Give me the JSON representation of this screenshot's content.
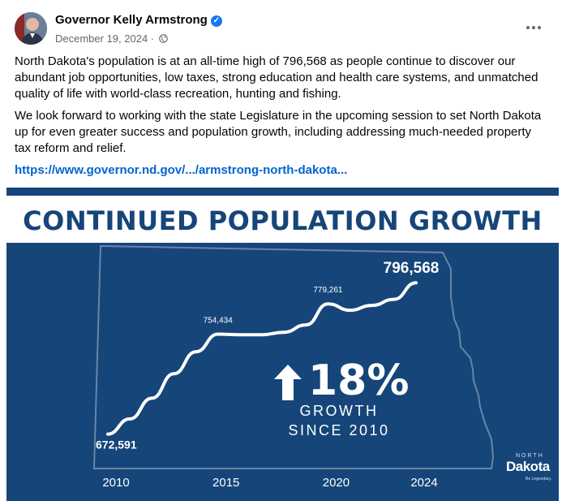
{
  "post": {
    "author": "Governor Kelly Armstrong",
    "date": "December 19, 2024",
    "date_suffix": " · ",
    "paragraph1": "North Dakota's population is at an all-time high of 796,568 as people continue to discover our abundant job opportunities, low taxes, strong education and health care systems, and unmatched quality of life with world-class recreation, hunting and fishing.",
    "paragraph2": "We look forward to working with the state Legislature in the upcoming session to set North Dakota up for even greater success and population growth, including addressing much-needed property tax reform and relief.",
    "link_text": "https://www.governor.nd.gov/.../armstrong-north-dakota..."
  },
  "graphic": {
    "title": "CONTINUED POPULATION GROWTH",
    "growth_percent": "18%",
    "growth_label": "GROWTH",
    "since_label": "SINCE 2010",
    "logo_top": "NORTH",
    "logo_name": "Dakota",
    "logo_tagline": "Be Legendary."
  },
  "colors": {
    "brand_blue": "#16457a",
    "link_blue": "#0064d1",
    "verified_blue": "#1877f2"
  },
  "chart_data": {
    "type": "line",
    "title": "CONTINUED POPULATION GROWTH",
    "x_ticks": [
      "2010",
      "2015",
      "2020",
      "2024"
    ],
    "x": [
      2010,
      2011,
      2012,
      2013,
      2014,
      2015,
      2016,
      2017,
      2018,
      2019,
      2020,
      2021,
      2022,
      2023,
      2024
    ],
    "values": [
      672591,
      685000,
      702000,
      722000,
      740000,
      754434,
      754000,
      754000,
      756000,
      762000,
      779261,
      774000,
      778000,
      783000,
      796568
    ],
    "labels": [
      {
        "x": 2010,
        "text": "672,591"
      },
      {
        "x": 2015,
        "text": "754,434"
      },
      {
        "x": 2020,
        "text": "779,261"
      },
      {
        "x": 2024,
        "text": "796,568"
      }
    ],
    "xlim": [
      2010,
      2024
    ],
    "ylim": [
      665000,
      800000
    ],
    "grid": false
  }
}
